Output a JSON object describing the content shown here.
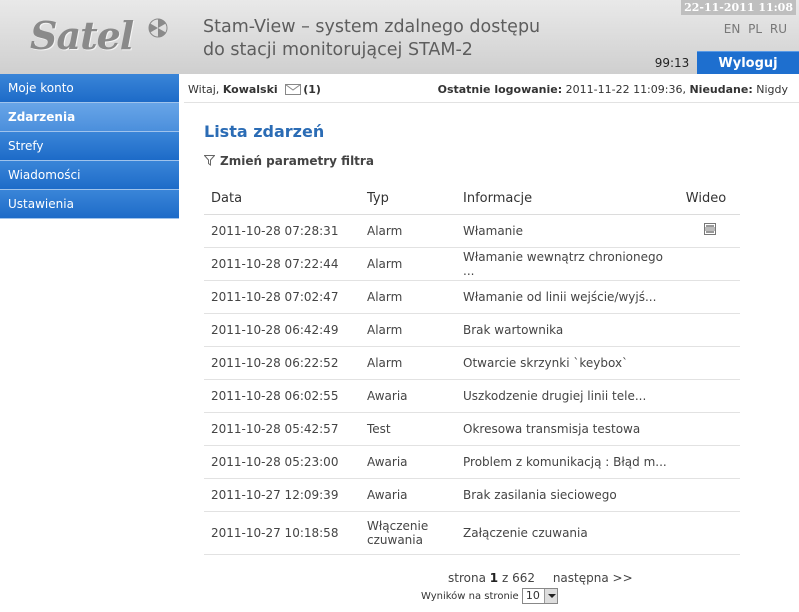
{
  "header": {
    "logo_text": "Satel",
    "title_line1": "Stam-View – system zdalnego dostępu",
    "title_line2": "do stacji monitorującej STAM-2",
    "datetime": "22-11-2011 11:08",
    "languages": [
      "EN",
      "PL",
      "RU"
    ],
    "session_timer": "99:13",
    "logout_label": "Wyloguj"
  },
  "sidebar": {
    "items": [
      {
        "label": "Moje konto"
      },
      {
        "label": "Zdarzenia"
      },
      {
        "label": "Strefy"
      },
      {
        "label": "Wiadomości"
      },
      {
        "label": "Ustawienia"
      }
    ]
  },
  "info_bar": {
    "greeting_prefix": "Witaj,",
    "user_name": "Kowalski",
    "message_count": "(1)",
    "last_login_label": "Ostatnie logowanie:",
    "last_login_value": "2011-11-22 11:09:36,",
    "failed_label": "Nieudane:",
    "failed_value": "Nigdy"
  },
  "main": {
    "title": "Lista zdarzeń",
    "filter_label": "Zmień parametry filtra",
    "columns": {
      "date": "Data",
      "type": "Typ",
      "info": "Informacje",
      "video": "Wideo"
    },
    "rows": [
      {
        "date": "2011-10-28 07:28:31",
        "type": "Alarm",
        "info": "Włamanie",
        "video": true
      },
      {
        "date": "2011-10-28 07:22:44",
        "type": "Alarm",
        "info": "Włamanie wewnątrz chronionego ...",
        "video": false
      },
      {
        "date": "2011-10-28 07:02:47",
        "type": "Alarm",
        "info": "Włamanie od linii wejście/wyjś...",
        "video": false
      },
      {
        "date": "2011-10-28 06:42:49",
        "type": "Alarm",
        "info": "Brak wartownika",
        "video": false
      },
      {
        "date": "2011-10-28 06:22:52",
        "type": "Alarm",
        "info": "Otwarcie skrzynki `keybox`",
        "video": false
      },
      {
        "date": "2011-10-28 06:02:55",
        "type": "Awaria",
        "info": "Uszkodzenie drugiej linii tele...",
        "video": false
      },
      {
        "date": "2011-10-28 05:42:57",
        "type": "Test",
        "info": "Okresowa transmisja testowa",
        "video": false
      },
      {
        "date": "2011-10-28 05:23:00",
        "type": "Awaria",
        "info": "Problem z komunikacją : Błąd m...",
        "video": false
      },
      {
        "date": "2011-10-27 12:09:39",
        "type": "Awaria",
        "info": "Brak zasilania sieciowego",
        "video": false
      },
      {
        "date": "2011-10-27 10:18:58",
        "type": "Włączenie czuwania",
        "info": "Załączenie czuwania",
        "video": false
      }
    ],
    "pagination": {
      "prefix": "strona",
      "current": "1",
      "separator": "z",
      "total": "662",
      "next_label": "następna >>"
    },
    "per_page": {
      "label": "Wyników na stronie",
      "value": "10"
    }
  }
}
